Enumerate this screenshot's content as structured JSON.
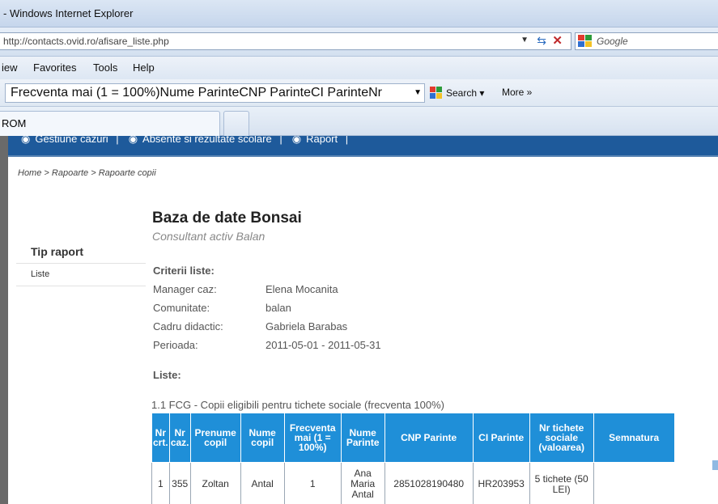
{
  "browser": {
    "title": "- Windows Internet Explorer",
    "url": "http://contacts.ovid.ro/afisare_liste.php",
    "search_placeholder": "Google",
    "menu": [
      "View",
      "Favorites",
      "Tools",
      "Help"
    ],
    "menu_visible": [
      "iew",
      "Favorites",
      "Tools",
      "Help"
    ],
    "toolbar_field": "Frecventa mai (1 = 100%)Nume ParinteCNP ParinteCI ParinteNr",
    "search_button": "Search",
    "more_button": "More »",
    "tab_title": "ROM"
  },
  "site": {
    "nav": [
      "Gestiune cazuri",
      "Absente si rezultate scolare",
      "Raport"
    ],
    "breadcrumb": [
      "Home",
      "Rapoarte",
      "Rapoarte copii"
    ],
    "breadcrumb_sep": ">",
    "title": "Baza de date Bonsai",
    "subtitle": "Consultant activ Balan"
  },
  "sidebar": {
    "heading": "Tip raport",
    "items": [
      {
        "label": "Liste"
      }
    ]
  },
  "criteria": {
    "heading": "Criterii liste:",
    "rows": [
      {
        "label": "Manager caz:",
        "value": "Elena Mocanita"
      },
      {
        "label": "Comunitate:",
        "value": "balan"
      },
      {
        "label": "Cadru didactic:",
        "value": "Gabriela Barabas"
      },
      {
        "label": "Perioada:",
        "value": "2011-05-01 - 2011-05-31"
      }
    ]
  },
  "lists": {
    "heading": "Liste:",
    "caption": "1.1 FCG - Copii eligibili pentru tichete sociale (frecventa 100%)",
    "columns": [
      "Nr crt.",
      "Nr caz.",
      "Prenume copil",
      "Nume copil",
      "Frecventa mai (1 = 100%)",
      "Nume Parinte",
      "CNP Parinte",
      "CI Parinte",
      "Nr tichete sociale (valoarea)",
      "Semnatura"
    ],
    "rows": [
      [
        "1",
        "355",
        "Zoltan",
        "Antal",
        "1",
        "Ana Maria Antal",
        "2851028190480",
        "HR203953",
        "5 tichete (50 LEI)",
        ""
      ]
    ]
  },
  "colors": {
    "nav_bar": "#1e5a9b",
    "table_header": "#1f8fd8"
  }
}
